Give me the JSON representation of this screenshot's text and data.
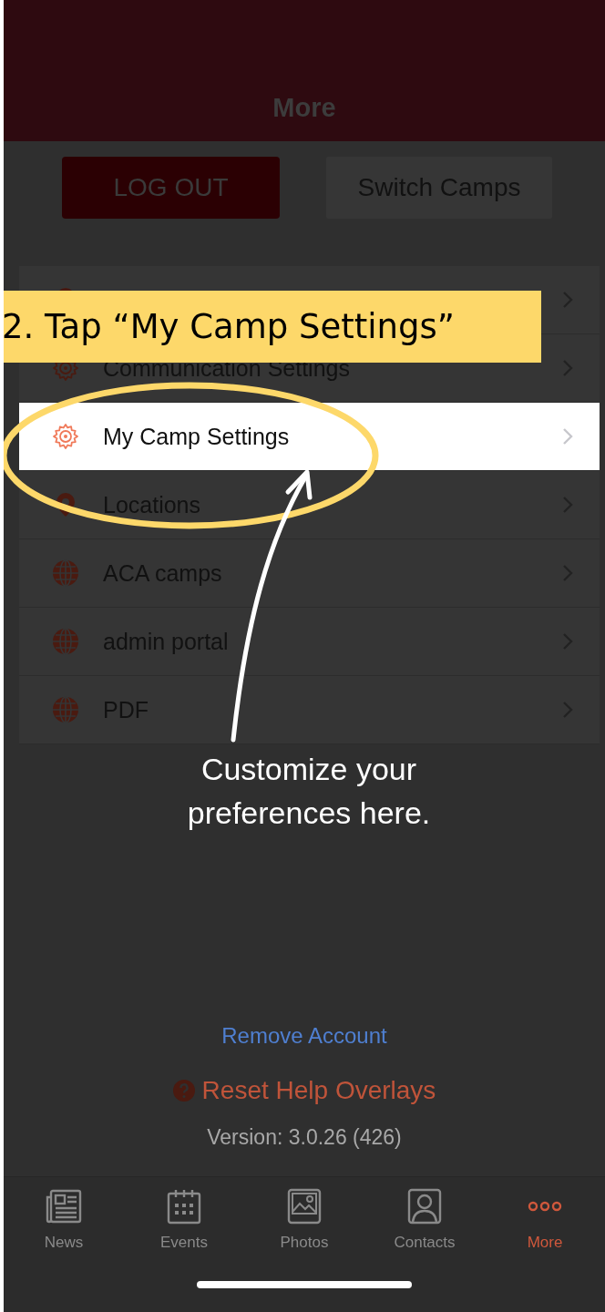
{
  "header": {
    "title": "More"
  },
  "buttons": {
    "logout": "LOG OUT",
    "switch": "Switch Camps"
  },
  "menu": [
    {
      "kind": "pin",
      "selected": false
    },
    {
      "kind": "gear",
      "label": "Communication Settings",
      "selected": false
    },
    {
      "kind": "gear",
      "label": "My Camp Settings",
      "selected": true
    },
    {
      "kind": "pin",
      "label": "Locations",
      "selected": false
    },
    {
      "kind": "globe",
      "label": "ACA camps",
      "selected": false
    },
    {
      "kind": "globe",
      "label": "admin portal",
      "selected": false
    },
    {
      "kind": "globe",
      "label": "PDF",
      "selected": false
    }
  ],
  "footer": {
    "remove_account": "Remove Account",
    "reset_help": "Reset Help Overlays",
    "version": "Version: 3.0.26 (426)"
  },
  "tabs": [
    {
      "kind": "news",
      "label": "News",
      "selected": false
    },
    {
      "kind": "events",
      "label": "Events",
      "selected": false
    },
    {
      "kind": "photos",
      "label": "Photos",
      "selected": false
    },
    {
      "kind": "contacts",
      "label": "Contacts",
      "selected": false
    },
    {
      "kind": "more",
      "label": "More",
      "selected": true
    }
  ],
  "overlay": {
    "step_banner": "2. Tap “My Camp Settings”",
    "callout": "Customize your preferences here."
  }
}
